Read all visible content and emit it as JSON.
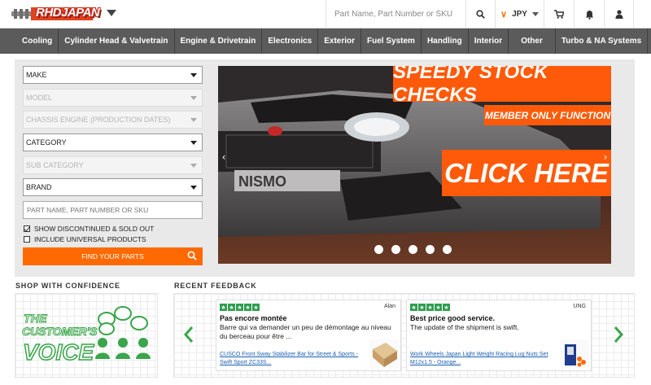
{
  "header": {
    "logo_text": "RHDJAPAN",
    "search_placeholder": "Part Name, Part Number or SKU",
    "currency": "JPY"
  },
  "nav": {
    "items": [
      "Cooling",
      "Cylinder Head & Valvetrain",
      "Engine & Drivetrain",
      "Electronics",
      "Exterior",
      "Fuel System",
      "Handling",
      "Interior",
      "Other",
      "Turbo & NA Systems"
    ]
  },
  "finder": {
    "make": "MAKE",
    "model": "MODEL",
    "chassis": "CHASSIS ENGINE (PRODUCTION DATES)",
    "category": "CATEGORY",
    "sub_category": "SUB CATEGORY",
    "brand": "BRAND",
    "part_placeholder": "PART NAME, PART NUMBER OR SKU",
    "show_discontinued": "SHOW DISCONTINUED & SOLD OUT",
    "include_universal": "INCLUDE UNIVERSAL PRODUCTS",
    "find_button": "FIND YOUR PARTS"
  },
  "banner": {
    "headline": "SPEEDY STOCK CHECKS",
    "subline": "MEMBER ONLY FUNCTION",
    "cta": "CLICK HERE",
    "slide_count": 5
  },
  "sections": {
    "confidence_title": "SHOP WITH CONFIDENCE",
    "feedback_title": "RECENT FEEDBACK"
  },
  "customer_voice": {
    "line1": "THE",
    "line2": "CUSTOMER'S",
    "line3": "VOICE"
  },
  "feedback": [
    {
      "user": "Alan",
      "title": "Pas encore montée",
      "body": "Barre qui va demander un peu de démontage au niveau du berceau pour être ...",
      "product": "CUSCO Front Sway Stabilizer Bar for Street & Sports - Swift Sport ZC33S..."
    },
    {
      "user": "UNG",
      "title": "Best price good service.",
      "body": "The update of the shipment is swift.",
      "product": "Work Wheels Japan Light Weight Racing Lug Nuts Set M12x1.5 - Orange..."
    }
  ],
  "colors": {
    "accent": "#ff6a00",
    "nav_bg": "#5b5b5b",
    "stars": "#2e9e4f",
    "voice_green": "#3aa54a"
  }
}
